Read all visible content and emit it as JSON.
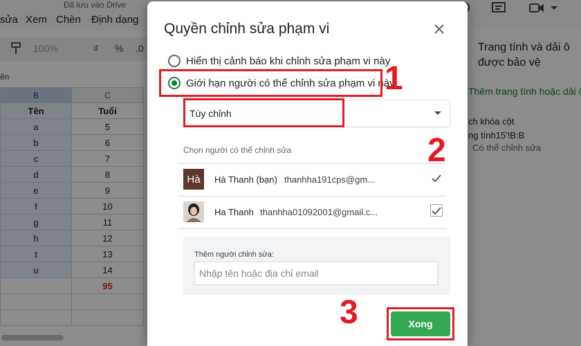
{
  "background": {
    "saved_status": "Đã lưu vào Drive",
    "menu": [
      "sửa",
      "Xem",
      "Chèn",
      "Định dạng"
    ],
    "toolbar": {
      "zoom": "100%",
      "currency": "₫",
      "percent": "%",
      "decimal": ".0"
    },
    "name_box": "ên",
    "sheet": {
      "col_headers": [
        "B",
        "C"
      ],
      "header_row": [
        "Tên",
        "Tuổi"
      ],
      "rows": [
        [
          "a",
          "5"
        ],
        [
          "b",
          "6"
        ],
        [
          "c",
          "7"
        ],
        [
          "d",
          "8"
        ],
        [
          "e",
          "9"
        ],
        [
          "f",
          "10"
        ],
        [
          "g",
          "11"
        ],
        [
          "h",
          "12"
        ],
        [
          "t",
          "13"
        ],
        [
          "u",
          "14"
        ],
        [
          "",
          "95"
        ]
      ]
    },
    "side_panel": {
      "title": "Trang tính và dải ô được bảo vệ",
      "add_link": "Thêm trang tính hoặc dải ô",
      "range_line1": "ch khóa cột",
      "range_line2": "ng tính15'!B:B",
      "permission": "Có thể chỉnh sửa"
    }
  },
  "dialog": {
    "title": "Quyền chỉnh sửa phạm vi",
    "close_icon": "close-icon",
    "options": [
      {
        "label": "Hiển thị cảnh báo khi chỉnh sửa phạm vi này",
        "selected": false
      },
      {
        "label": "Giới hạn người có thể chỉnh sửa phạm vi này",
        "selected": true
      }
    ],
    "select_value": "Tùy chỉnh",
    "choose_label": "Chọn người có thể chỉnh sửa",
    "users": [
      {
        "avatar_text": "Hà",
        "name": "Hà Thanh (bạn)",
        "email": "thanhha191cps@gm...",
        "checked": true
      },
      {
        "avatar_text": "",
        "name": "Ha Thanh",
        "email": "thanhha01092001@gmail.c...",
        "checked": true
      }
    ],
    "add_editors_label": "Thêm người chỉnh sửa:",
    "add_editors_placeholder": "Nhập tên hoặc địa chỉ email",
    "done_label": "Xong"
  },
  "annotations": {
    "step1": "1",
    "step2": "2",
    "step3": "3",
    "color": "#e31b23"
  },
  "colors": {
    "accent_green": "#188038",
    "button_green": "#34a853"
  }
}
